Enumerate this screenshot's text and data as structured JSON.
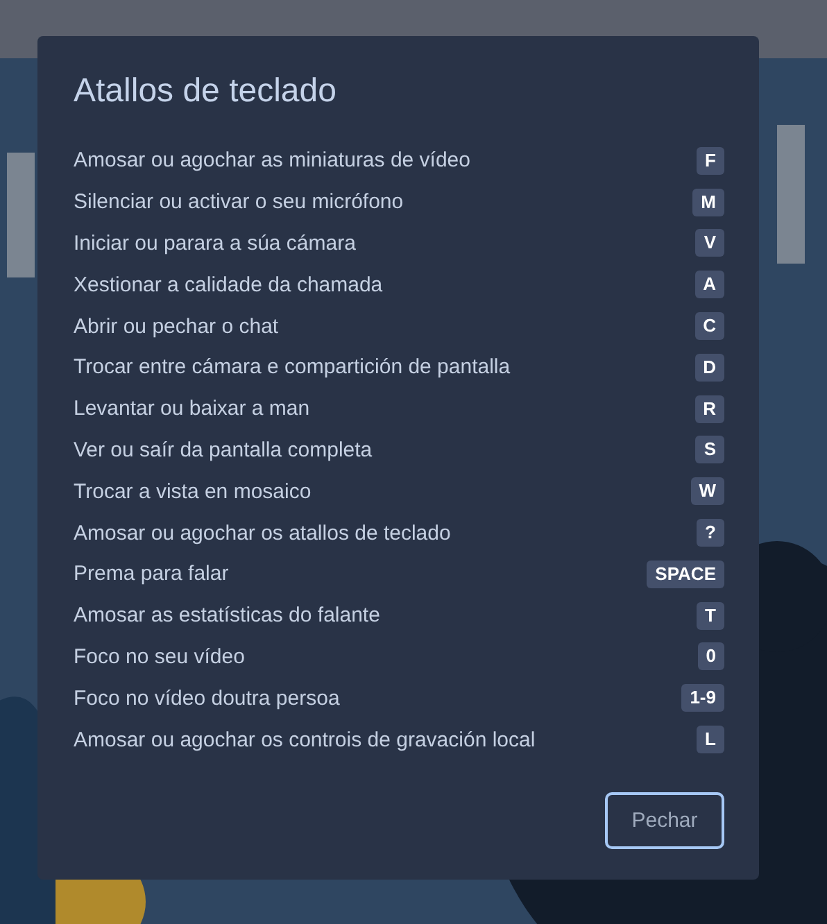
{
  "dialog": {
    "title": "Atallos de teclado",
    "shortcuts": [
      {
        "label": "Amosar ou agochar as miniaturas de vídeo",
        "key": "F"
      },
      {
        "label": "Silenciar ou activar o seu micrófono",
        "key": "M"
      },
      {
        "label": "Iniciar ou parara a súa cámara",
        "key": "V"
      },
      {
        "label": "Xestionar a calidade da chamada",
        "key": "A"
      },
      {
        "label": "Abrir ou pechar o chat",
        "key": "C"
      },
      {
        "label": "Trocar entre cámara e compartición de pantalla",
        "key": "D"
      },
      {
        "label": "Levantar ou baixar a man",
        "key": "R"
      },
      {
        "label": "Ver ou saír da pantalla completa",
        "key": "S"
      },
      {
        "label": "Trocar a vista en mosaico",
        "key": "W"
      },
      {
        "label": "Amosar ou agochar os atallos de teclado",
        "key": "?"
      },
      {
        "label": "Prema para falar",
        "key": "SPACE"
      },
      {
        "label": "Amosar as estatísticas do falante",
        "key": "T"
      },
      {
        "label": "Foco no seu vídeo",
        "key": "0"
      },
      {
        "label": "Foco no vídeo doutra persoa",
        "key": "1-9"
      },
      {
        "label": "Amosar ou agochar os controis de gravación local",
        "key": "L"
      }
    ],
    "close_button": "Pechar"
  }
}
